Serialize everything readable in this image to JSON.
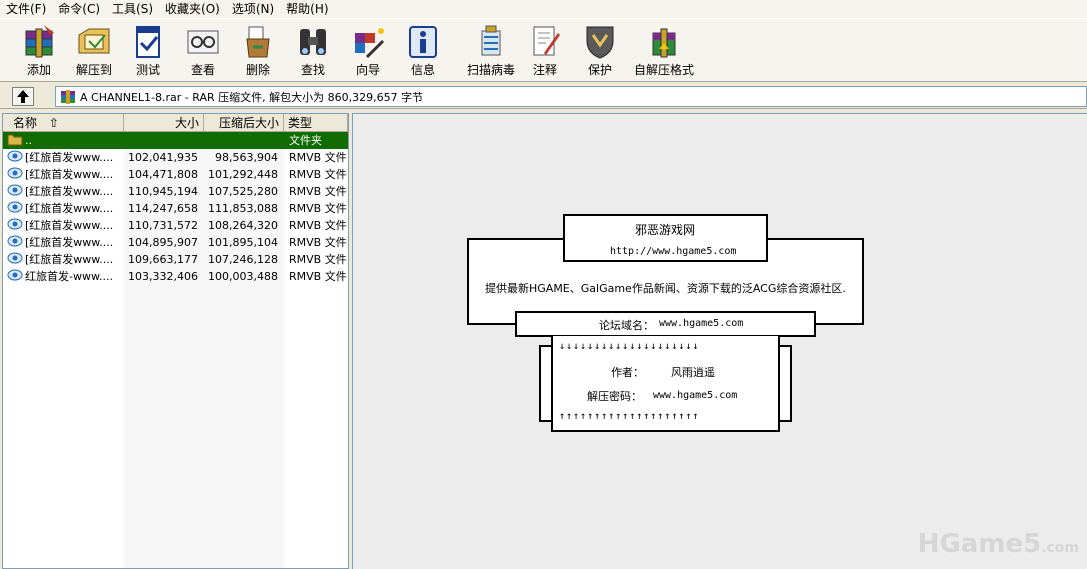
{
  "menu": [
    "文件(F)",
    "命令(C)",
    "工具(S)",
    "收藏夹(O)",
    "选项(N)",
    "帮助(H)"
  ],
  "toolbar": [
    {
      "label": "添加",
      "icon": "add-archive-icon"
    },
    {
      "label": "解压到",
      "icon": "extract-to-icon"
    },
    {
      "label": "测试",
      "icon": "test-icon"
    },
    {
      "label": "查看",
      "icon": "view-icon"
    },
    {
      "label": "删除",
      "icon": "delete-icon"
    },
    {
      "label": "查找",
      "icon": "find-binoculars-icon"
    },
    {
      "label": "向导",
      "icon": "wizard-icon"
    },
    {
      "label": "信息",
      "icon": "info-icon"
    },
    {
      "label": "扫描病毒",
      "icon": "virus-scan-icon"
    },
    {
      "label": "注释",
      "icon": "comment-icon"
    },
    {
      "label": "保护",
      "icon": "protect-shield-icon"
    },
    {
      "label": "自解压格式",
      "icon": "sfx-icon"
    }
  ],
  "address": {
    "text": "A CHANNEL1-8.rar - RAR 压缩文件, 解包大小为 860,329,657 字节"
  },
  "columns": {
    "name": "名称",
    "size": "大小",
    "csize": "压缩后大小",
    "type": "类型"
  },
  "rows": [
    {
      "name": "..",
      "size": "",
      "csize": "",
      "type": "文件夹",
      "icon": "folder-icon",
      "selected": true
    },
    {
      "name": "[红旅首发www....",
      "size": "102,041,935",
      "csize": "98,563,904",
      "type": "RMVB 文件",
      "icon": "rmvb-file-icon"
    },
    {
      "name": "[红旅首发www....",
      "size": "104,471,808",
      "csize": "101,292,448",
      "type": "RMVB 文件",
      "icon": "rmvb-file-icon"
    },
    {
      "name": "[红旅首发www....",
      "size": "110,945,194",
      "csize": "107,525,280",
      "type": "RMVB 文件",
      "icon": "rmvb-file-icon"
    },
    {
      "name": "[红旅首发www....",
      "size": "114,247,658",
      "csize": "111,853,088",
      "type": "RMVB 文件",
      "icon": "rmvb-file-icon"
    },
    {
      "name": "[红旅首发www....",
      "size": "110,731,572",
      "csize": "108,264,320",
      "type": "RMVB 文件",
      "icon": "rmvb-file-icon"
    },
    {
      "name": "[红旅首发www....",
      "size": "104,895,907",
      "csize": "101,895,104",
      "type": "RMVB 文件",
      "icon": "rmvb-file-icon"
    },
    {
      "name": "[红旅首发www....",
      "size": "109,663,177",
      "csize": "107,246,128",
      "type": "RMVB 文件",
      "icon": "rmvb-file-icon"
    },
    {
      "name": "红旅首发-www....",
      "size": "103,332,406",
      "csize": "100,003,488",
      "type": "RMVB 文件",
      "icon": "rmvb-file-icon"
    }
  ],
  "comment": {
    "site_name": "邪恶游戏网",
    "site_url": "http://www.hgame5.com",
    "desc": "提供最新HGAME、GalGame作品新闻、资源下载的泛ACG综合资源社区.",
    "forum_label": "论坛域名：",
    "forum_url": "www.hgame5.com",
    "down_arrows": "↓↓↓↓↓↓↓↓↓↓↓↓↓↓↓↓↓↓↓↓",
    "author_label": "作者：",
    "author": "风雨逍遥",
    "pwd_label": "解压密码：",
    "pwd": "www.hgame5.com",
    "up_arrows": "↑↑↑↑↑↑↑↑↑↑↑↑↑↑↑↑↑↑↑↑"
  },
  "watermark": {
    "main": "HGame5",
    "suffix": ".com"
  }
}
